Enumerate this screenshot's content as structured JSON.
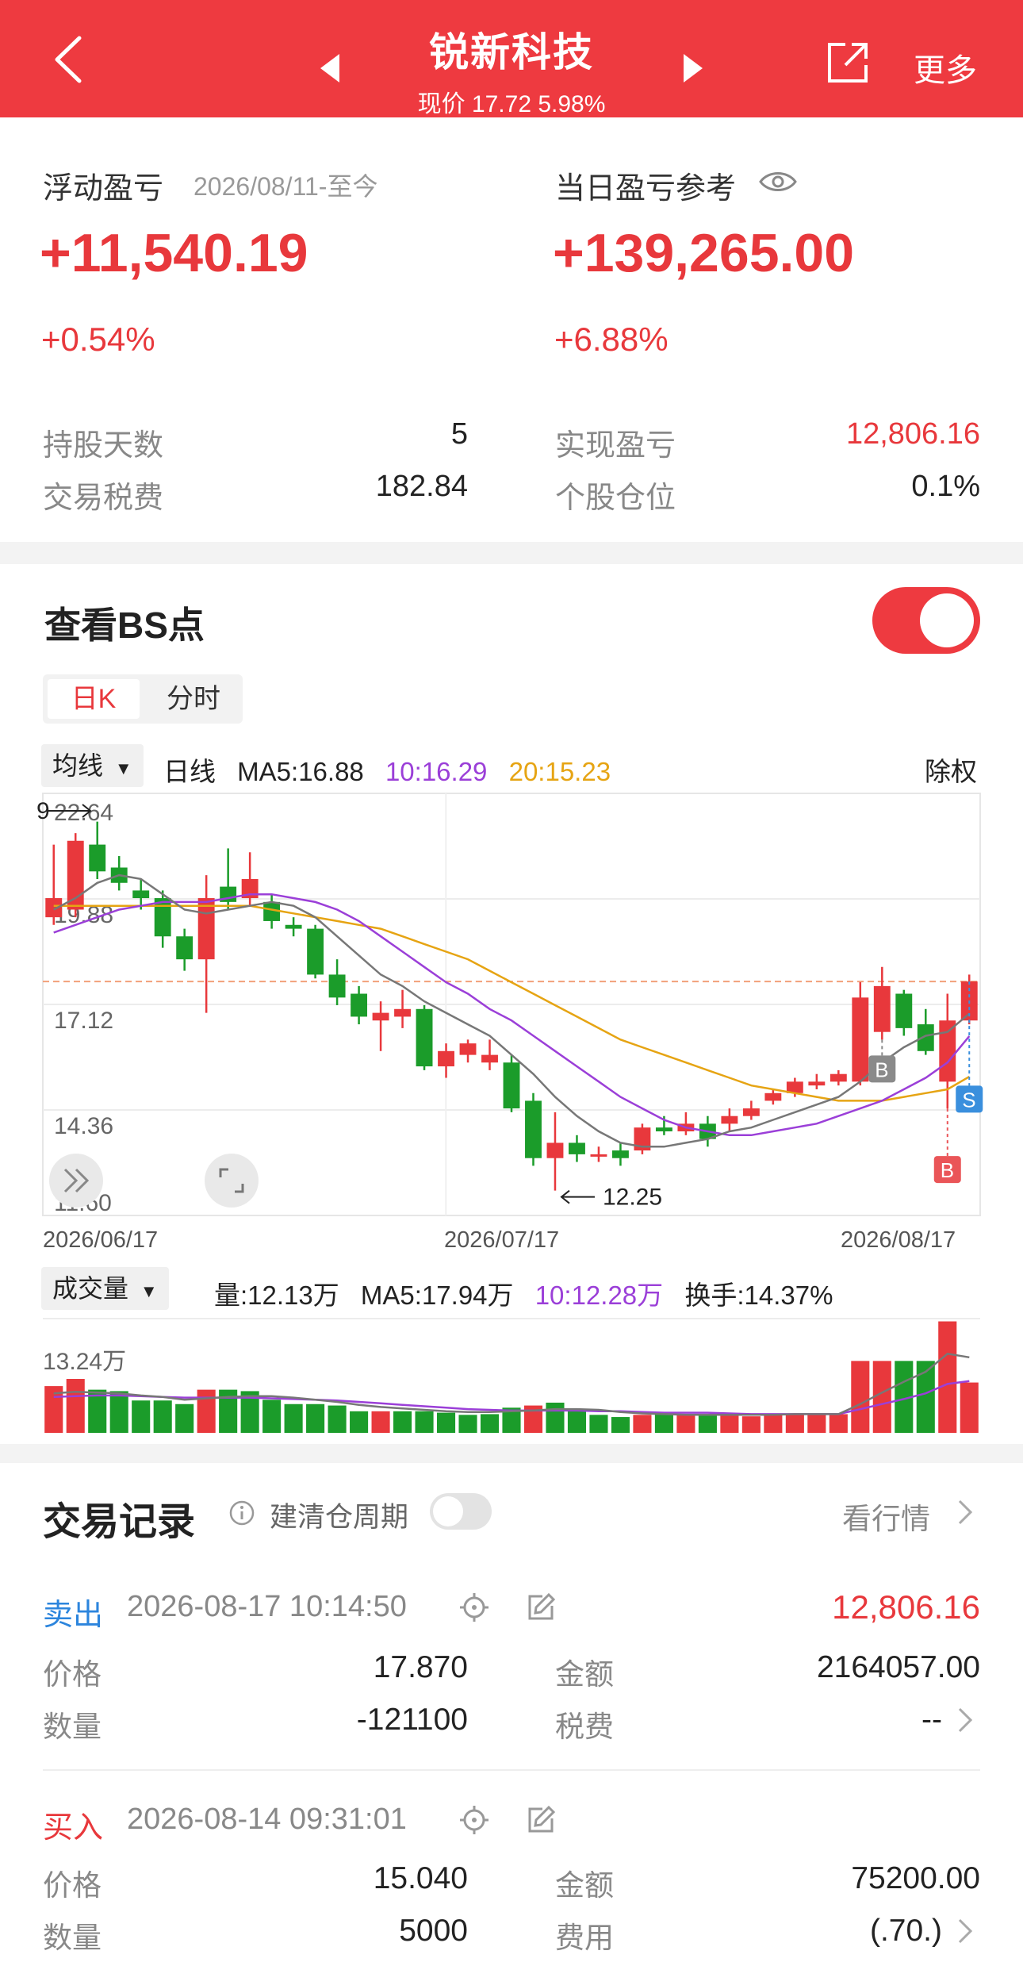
{
  "header": {
    "title": "锐新科技",
    "subtitle": "现价 17.72 5.98%",
    "more": "更多"
  },
  "summary": {
    "float_label": "浮动盈亏",
    "float_date": "2026/08/11-至今",
    "float_value": "+11,540.19",
    "float_pct": "+0.54%",
    "day_label": "当日盈亏参考",
    "day_value": "+139,265.00",
    "day_pct": "+6.88%",
    "hold_days_label": "持股天数",
    "hold_days": "5",
    "fee_label": "交易税费",
    "fee": "182.84",
    "realized_label": "实现盈亏",
    "realized": "12,806.16",
    "position_label": "个股仓位",
    "position": "0.1%"
  },
  "bs": {
    "title": "查看BS点",
    "tabs": [
      "日K",
      "分时"
    ],
    "ma_button": "均线",
    "period": "日线",
    "ma5": "MA5:16.88",
    "ma10": "10:16.29",
    "ma20": "20:15.23",
    "fq": "除权",
    "vol_button": "成交量",
    "vol": "量:12.13万",
    "vol_ma5": "MA5:17.94万",
    "vol_ma10": "10:12.28万",
    "turnover": "换手:14.37%"
  },
  "chart_data": [
    {
      "type": "candlestick",
      "title": "日K",
      "ylim": [
        11.6,
        22.64
      ],
      "y_ticks": [
        "22.64",
        "19.88",
        "17.12",
        "14.36",
        "11.60"
      ],
      "x_tick_labels": [
        "2026/06/17",
        "2026/07/17",
        "2026/08/17"
      ],
      "annotations": {
        "low_label": "12.25",
        "high_marker_partial": "9"
      },
      "candles": [
        {
          "o": 19.4,
          "c": 19.9,
          "h": 21.3,
          "l": 19.2
        },
        {
          "o": 19.6,
          "c": 21.4,
          "h": 21.6,
          "l": 19.4
        },
        {
          "o": 21.3,
          "c": 20.6,
          "h": 21.9,
          "l": 20.4
        },
        {
          "o": 20.7,
          "c": 20.3,
          "h": 21.0,
          "l": 20.1
        },
        {
          "o": 20.1,
          "c": 19.9,
          "h": 20.4,
          "l": 19.6
        },
        {
          "o": 19.9,
          "c": 18.9,
          "h": 20.1,
          "l": 18.6
        },
        {
          "o": 18.9,
          "c": 18.3,
          "h": 19.1,
          "l": 18.0
        },
        {
          "o": 18.3,
          "c": 19.9,
          "h": 20.5,
          "l": 16.9
        },
        {
          "o": 20.2,
          "c": 19.8,
          "h": 21.2,
          "l": 19.6
        },
        {
          "o": 19.9,
          "c": 20.4,
          "h": 21.1,
          "l": 19.7
        },
        {
          "o": 19.8,
          "c": 19.3,
          "h": 20.0,
          "l": 19.1
        },
        {
          "o": 19.2,
          "c": 19.1,
          "h": 19.4,
          "l": 18.9
        },
        {
          "o": 19.1,
          "c": 17.9,
          "h": 19.2,
          "l": 17.8
        },
        {
          "o": 17.9,
          "c": 17.3,
          "h": 18.3,
          "l": 17.1
        },
        {
          "o": 17.4,
          "c": 16.8,
          "h": 17.6,
          "l": 16.6
        },
        {
          "o": 16.7,
          "c": 16.9,
          "h": 17.2,
          "l": 15.9
        },
        {
          "o": 16.8,
          "c": 17.0,
          "h": 17.5,
          "l": 16.5
        },
        {
          "o": 17.0,
          "c": 15.5,
          "h": 17.1,
          "l": 15.4
        },
        {
          "o": 15.5,
          "c": 15.9,
          "h": 16.1,
          "l": 15.2
        },
        {
          "o": 15.8,
          "c": 16.1,
          "h": 16.2,
          "l": 15.6
        },
        {
          "o": 15.6,
          "c": 15.8,
          "h": 16.2,
          "l": 15.4
        },
        {
          "o": 15.6,
          "c": 14.4,
          "h": 15.8,
          "l": 14.3
        },
        {
          "o": 14.6,
          "c": 13.1,
          "h": 14.8,
          "l": 12.9
        },
        {
          "o": 13.1,
          "c": 13.5,
          "h": 14.3,
          "l": 12.25
        },
        {
          "o": 13.5,
          "c": 13.2,
          "h": 13.7,
          "l": 13.0
        },
        {
          "o": 13.2,
          "c": 13.2,
          "h": 13.4,
          "l": 13.0
        },
        {
          "o": 13.3,
          "c": 13.1,
          "h": 13.5,
          "l": 12.9
        },
        {
          "o": 13.3,
          "c": 13.9,
          "h": 14.0,
          "l": 13.2
        },
        {
          "o": 13.9,
          "c": 13.8,
          "h": 14.2,
          "l": 13.7
        },
        {
          "o": 13.8,
          "c": 14.0,
          "h": 14.3,
          "l": 13.7
        },
        {
          "o": 14.0,
          "c": 13.6,
          "h": 14.2,
          "l": 13.4
        },
        {
          "o": 14.0,
          "c": 14.2,
          "h": 14.4,
          "l": 13.8
        },
        {
          "o": 14.2,
          "c": 14.4,
          "h": 14.6,
          "l": 14.1
        },
        {
          "o": 14.6,
          "c": 14.8,
          "h": 14.9,
          "l": 14.5
        },
        {
          "o": 14.8,
          "c": 15.1,
          "h": 15.2,
          "l": 14.7
        },
        {
          "o": 15.0,
          "c": 15.1,
          "h": 15.3,
          "l": 14.9
        },
        {
          "o": 15.1,
          "c": 15.3,
          "h": 15.4,
          "l": 15.0
        },
        {
          "o": 15.1,
          "c": 17.3,
          "h": 17.7,
          "l": 15.0
        },
        {
          "o": 16.4,
          "c": 17.6,
          "h": 18.1,
          "l": 16.2
        },
        {
          "o": 17.4,
          "c": 16.5,
          "h": 17.5,
          "l": 16.3
        },
        {
          "o": 16.6,
          "c": 15.9,
          "h": 17.0,
          "l": 15.8
        },
        {
          "o": 15.1,
          "c": 16.7,
          "h": 17.4,
          "l": 14.4
        },
        {
          "o": 16.7,
          "c": 17.72,
          "h": 17.9,
          "l": 16.6
        }
      ],
      "ma5": [
        19.6,
        19.9,
        20.3,
        20.5,
        20.4,
        20.0,
        19.6,
        19.5,
        19.6,
        19.7,
        19.8,
        19.7,
        19.4,
        18.9,
        18.4,
        17.9,
        17.6,
        17.2,
        16.9,
        16.6,
        16.3,
        15.8,
        15.3,
        14.7,
        14.2,
        13.8,
        13.5,
        13.4,
        13.4,
        13.5,
        13.6,
        13.8,
        13.9,
        14.1,
        14.3,
        14.5,
        14.7,
        15.1,
        15.6,
        16.0,
        16.3,
        16.4,
        16.88
      ],
      "ma10": [
        19.0,
        19.2,
        19.4,
        19.6,
        19.7,
        19.8,
        19.8,
        19.8,
        19.9,
        20.0,
        20.0,
        19.9,
        19.8,
        19.6,
        19.3,
        18.9,
        18.5,
        18.1,
        17.7,
        17.4,
        17.0,
        16.7,
        16.3,
        15.9,
        15.5,
        15.1,
        14.7,
        14.4,
        14.1,
        13.9,
        13.8,
        13.7,
        13.7,
        13.8,
        13.9,
        14.0,
        14.2,
        14.4,
        14.6,
        14.9,
        15.2,
        15.6,
        16.29
      ],
      "ma20": [
        19.7,
        19.7,
        19.7,
        19.7,
        19.7,
        19.7,
        19.7,
        19.7,
        19.7,
        19.7,
        19.6,
        19.5,
        19.4,
        19.3,
        19.2,
        19.1,
        18.9,
        18.7,
        18.5,
        18.3,
        18.0,
        17.7,
        17.4,
        17.1,
        16.8,
        16.5,
        16.2,
        16.0,
        15.8,
        15.6,
        15.4,
        15.2,
        15.0,
        14.9,
        14.8,
        14.7,
        14.6,
        14.6,
        14.6,
        14.7,
        14.8,
        14.9,
        15.23
      ],
      "markers": [
        {
          "index": 38,
          "label": "B"
        },
        {
          "index": 41,
          "label": "B"
        },
        {
          "index": 42,
          "label": "S"
        }
      ]
    },
    {
      "type": "bar",
      "title": "成交量",
      "unit": "万",
      "ylim": [
        0,
        13.24
      ],
      "y_ticks": [
        "13.24万"
      ],
      "values": [
        6.5,
        7.5,
        6.0,
        5.8,
        4.5,
        4.5,
        4.0,
        6.0,
        6.0,
        5.8,
        4.6,
        4.0,
        4.0,
        3.8,
        3.0,
        3.0,
        3.0,
        3.0,
        2.8,
        2.5,
        2.6,
        3.5,
        3.8,
        4.2,
        3.0,
        2.5,
        2.2,
        2.5,
        2.6,
        2.5,
        2.6,
        2.5,
        2.3,
        2.6,
        2.6,
        2.5,
        2.6,
        10.0,
        10.0,
        10.0,
        10.0,
        15.5,
        7.0
      ],
      "up": [
        true,
        true,
        false,
        false,
        false,
        false,
        false,
        true,
        false,
        false,
        false,
        false,
        false,
        false,
        false,
        true,
        false,
        false,
        false,
        false,
        false,
        false,
        true,
        false,
        false,
        false,
        false,
        true,
        false,
        true,
        false,
        true,
        true,
        true,
        true,
        true,
        true,
        true,
        true,
        false,
        false,
        true,
        true
      ],
      "ma5": [
        5.5,
        5.7,
        5.6,
        5.5,
        5.2,
        5.0,
        4.6,
        4.8,
        5.0,
        5.1,
        5.1,
        4.9,
        4.6,
        4.3,
        3.9,
        3.6,
        3.4,
        3.2,
        3.0,
        2.9,
        2.9,
        3.0,
        3.1,
        3.3,
        3.3,
        3.2,
        2.9,
        2.7,
        2.6,
        2.5,
        2.5,
        2.5,
        2.5,
        2.5,
        2.6,
        2.6,
        2.6,
        4.0,
        5.6,
        7.1,
        8.5,
        11.0,
        10.5
      ],
      "ma10": [
        5.0,
        5.1,
        5.2,
        5.2,
        5.1,
        5.0,
        4.9,
        4.9,
        4.9,
        4.9,
        4.8,
        4.7,
        4.6,
        4.5,
        4.3,
        4.1,
        3.9,
        3.7,
        3.5,
        3.3,
        3.2,
        3.1,
        3.1,
        3.1,
        3.1,
        3.0,
        3.0,
        2.9,
        2.8,
        2.8,
        2.8,
        2.7,
        2.6,
        2.6,
        2.6,
        2.6,
        2.6,
        3.3,
        4.0,
        4.7,
        5.5,
        6.8,
        7.2
      ]
    }
  ],
  "trades": {
    "title": "交易记录",
    "cycle_label": "建清仓周期",
    "market_link": "看行情",
    "records": [
      {
        "type": "卖出",
        "time": "2026-08-17 10:14:50",
        "amount_top": "12,806.16",
        "price_label": "价格",
        "price": "17.870",
        "money_label": "金额",
        "money": "2164057.00",
        "qty_label": "数量",
        "qty": "-121100",
        "fee_label": "税费",
        "fee": "--"
      },
      {
        "type": "买入",
        "time": "2026-08-14 09:31:01",
        "price_label": "价格",
        "price": "15.040",
        "money_label": "金额",
        "money": "75200.00",
        "qty_label": "数量",
        "qty": "5000",
        "fee_label": "费用",
        "fee": "(.70.)"
      }
    ]
  },
  "colors": {
    "brand_red": "#ee3a40",
    "up": "#e8383c",
    "down": "#1b9c2a",
    "ma5": "#777777",
    "ma10": "#9b3fd8",
    "ma20": "#e6a413",
    "sell_blue": "#2c85dd"
  }
}
